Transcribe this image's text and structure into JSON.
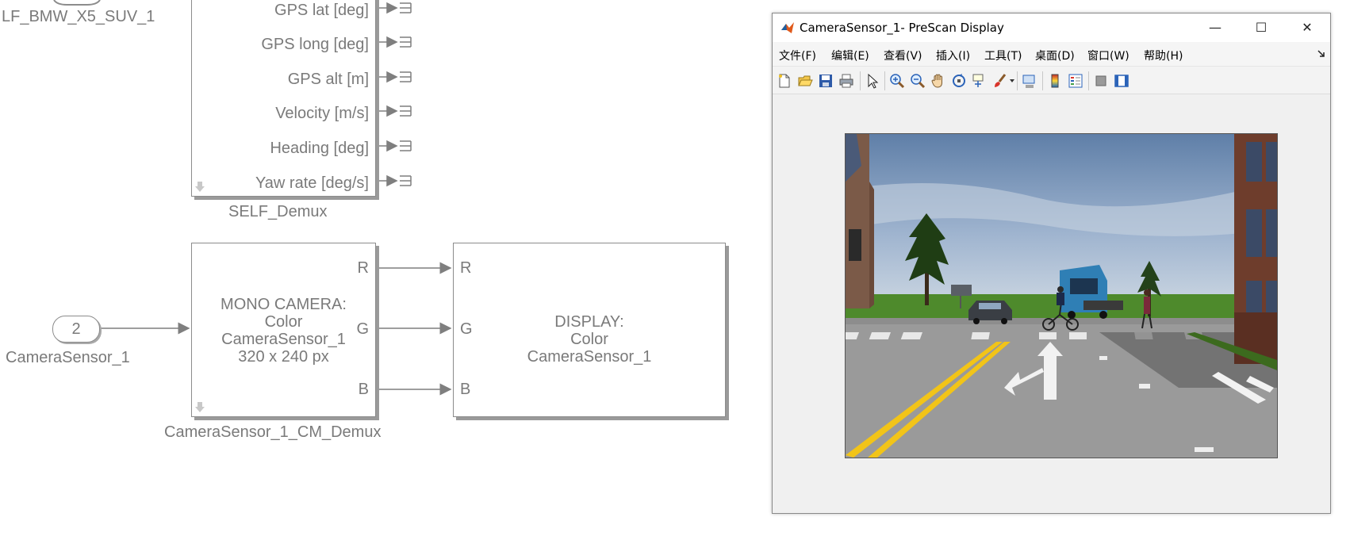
{
  "diagram": {
    "top_inport_label": "LF_BMW_X5_SUV_1",
    "self_demux": {
      "name": "SELF_Demux",
      "ports": [
        "GPS lat [deg]",
        "GPS long [deg]",
        "GPS alt [m]",
        "Velocity [m/s]",
        "Heading [deg]",
        "Yaw rate [deg/s]"
      ]
    },
    "inport2": {
      "number": "2",
      "label": "CameraSensor_1"
    },
    "mono_camera": {
      "name": "CameraSensor_1_CM_Demux",
      "lines": [
        "MONO CAMERA:",
        "Color",
        "CameraSensor_1",
        "320 x 240 px"
      ],
      "ports": [
        "R",
        "G",
        "B"
      ]
    },
    "display": {
      "lines": [
        "DISPLAY:",
        "Color",
        "CameraSensor_1"
      ],
      "ports": [
        "R",
        "G",
        "B"
      ]
    }
  },
  "figure_window": {
    "title": "CameraSensor_1- PreScan Display",
    "controls": {
      "minimize": "—",
      "maximize": "☐",
      "close": "✕"
    },
    "menu": [
      "文件(F)",
      "编辑(E)",
      "查看(V)",
      "插入(I)",
      "工具(T)",
      "桌面(D)",
      "窗口(W)",
      "帮助(H)"
    ],
    "menu_corner_icon": "dock-arrow-icon",
    "toolbar_icons": [
      "new-figure-icon",
      "open-file-icon",
      "save-icon",
      "print-icon",
      "pointer-icon",
      "zoom-in-icon",
      "zoom-out-icon",
      "pan-hand-icon",
      "rotate-3d-icon",
      "data-cursor-icon",
      "brush-icon",
      "link-plot-icon",
      "colorbar-icon",
      "legend-icon",
      "hide-plot-tools-icon",
      "show-plot-tools-icon"
    ]
  }
}
